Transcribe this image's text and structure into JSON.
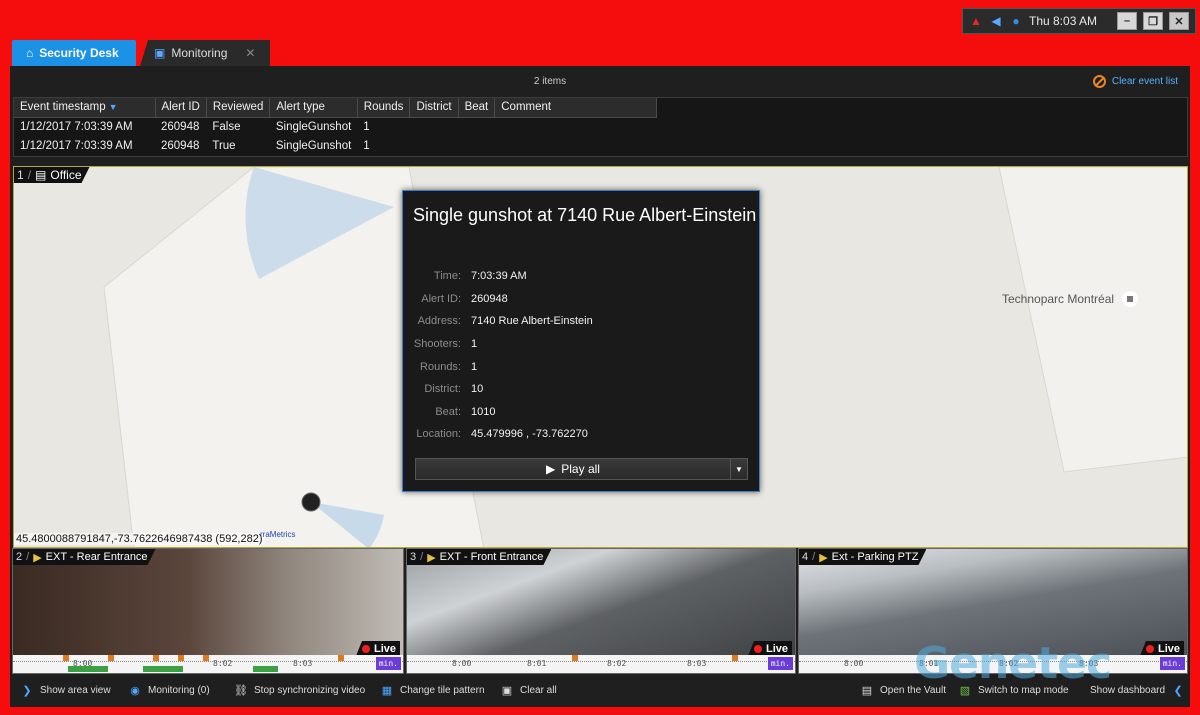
{
  "tray": {
    "time": "Thu 8:03 AM",
    "icons": [
      "alarm-icon",
      "speaker-icon",
      "globe-icon"
    ],
    "window_buttons": [
      "minimize",
      "restore",
      "close"
    ]
  },
  "tabs": [
    {
      "label": "Security Desk",
      "icon": "home-icon",
      "active": true
    },
    {
      "label": "Monitoring",
      "icon": "monitoring-icon",
      "active": false
    }
  ],
  "events": {
    "count_label": "2 items",
    "clear_label": "Clear event list",
    "columns": [
      "Event timestamp",
      "Alert ID",
      "Reviewed",
      "Alert type",
      "Rounds",
      "District",
      "Beat",
      "Comment"
    ],
    "rows": [
      [
        "1/12/2017 7:03:39 AM",
        "260948",
        "False",
        "SingleGunshot",
        "1",
        "",
        "",
        ""
      ],
      [
        "1/12/2017 7:03:39 AM",
        "260948",
        "True",
        "SingleGunshot",
        "1",
        "",
        "",
        ""
      ]
    ]
  },
  "map_tile": {
    "number": "1",
    "label": "Office",
    "poi": "Technoparc Montréal",
    "coords": "45.4800088791847,-73.7622646987438 (592,282)",
    "attribution": "rraMetrics"
  },
  "popup": {
    "title": "Single gunshot at 7140 Rue Albert-Einstein",
    "fields": [
      {
        "key": "Time:",
        "value": "7:03:39 AM"
      },
      {
        "key": "Alert ID:",
        "value": "260948"
      },
      {
        "key": "Address:",
        "value": "7140 Rue Albert-Einstein"
      },
      {
        "key": "Shooters:",
        "value": "1"
      },
      {
        "key": "Rounds:",
        "value": "1"
      },
      {
        "key": "District:",
        "value": "10"
      },
      {
        "key": "Beat:",
        "value": "1010"
      },
      {
        "key": "Location:",
        "value": "45.479996 , -73.762270"
      }
    ],
    "play_label": "Play all"
  },
  "cameras": [
    {
      "number": "2",
      "label": "EXT - Rear Entrance",
      "live": "Live",
      "times": [
        "8:00",
        "8:02",
        "8:03"
      ],
      "mins": "min."
    },
    {
      "number": "3",
      "label": "EXT - Front Entrance",
      "live": "Live",
      "times": [
        "8:00",
        "8:01",
        "8:02",
        "8:03"
      ],
      "mins": "min."
    },
    {
      "number": "4",
      "label": "Ext - Parking PTZ",
      "live": "Live",
      "times": [
        "8:00",
        "8:01",
        "8:02",
        "8:03"
      ],
      "mins": "min."
    }
  ],
  "toolbar": {
    "show_area_view": "Show area view",
    "monitoring": "Monitoring (0)",
    "stop_sync": "Stop synchronizing video",
    "change_tile": "Change tile pattern",
    "clear_all": "Clear all",
    "open_vault": "Open the Vault",
    "switch_map": "Switch to map mode",
    "show_dashboard": "Show dashboard"
  },
  "watermark": "Genetec",
  "colors": {
    "frame": "#f50d0d",
    "tab_active": "#1b92e6",
    "popup_border": "#3a7dc9",
    "live_dot": "#f02020",
    "timeline_green": "#3aa043",
    "event_marker": "#e0781e"
  }
}
